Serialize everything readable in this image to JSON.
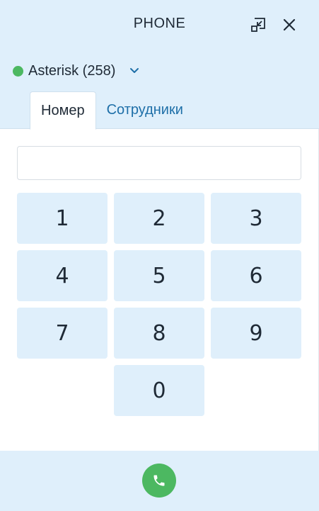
{
  "header": {
    "title": "PHONE",
    "minimize_icon": "minimize-window-icon",
    "close_icon": "close-icon"
  },
  "account": {
    "label": "Asterisk (258)",
    "status_color": "#4cb861",
    "chevron_icon": "chevron-down-icon"
  },
  "tabs": [
    {
      "label": "Номер",
      "active": true
    },
    {
      "label": "Сотрудники",
      "active": false
    }
  ],
  "dial_input": {
    "value": "",
    "placeholder": ""
  },
  "keypad": {
    "keys": [
      "1",
      "2",
      "3",
      "4",
      "5",
      "6",
      "7",
      "8",
      "9",
      "0"
    ]
  },
  "footer": {
    "call_icon": "phone-icon",
    "call_color": "#4cb861"
  },
  "colors": {
    "panel_bg": "#dfeffb",
    "accent_link": "#1e6fa8",
    "text": "#1f2a36"
  }
}
